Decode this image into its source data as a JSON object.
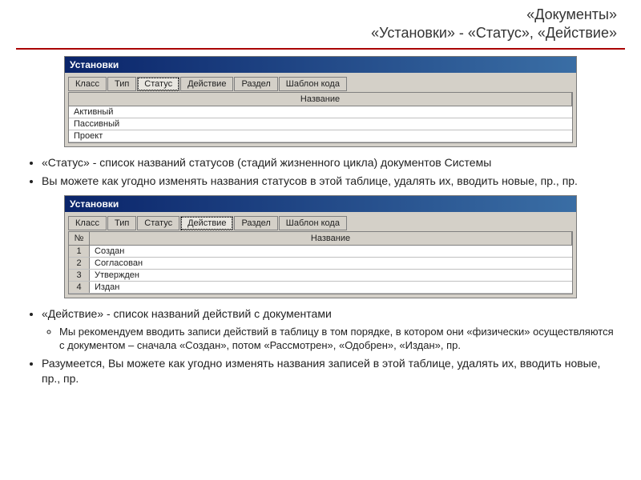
{
  "header": {
    "line1": "«Документы»",
    "line2": "«Установки» - «Статус», «Действие»"
  },
  "win1": {
    "title": "Установки",
    "tabs": [
      "Класс",
      "Тип",
      "Статус",
      "Действие",
      "Раздел",
      "Шаблон кода"
    ],
    "active_tab_index": 2,
    "column_header": "Название",
    "rows": [
      "Активный",
      "Пассивный",
      "Проект"
    ]
  },
  "text1": {
    "b1": "«Статус» - список названий статусов (стадий жизненного цикла) документов Системы",
    "b2": "Вы можете как угодно изменять названия статусов в этой таблице, удалять их, вводить новые, пр., пр."
  },
  "win2": {
    "title": "Установки",
    "tabs": [
      "Класс",
      "Тип",
      "Статус",
      "Действие",
      "Раздел",
      "Шаблон кода"
    ],
    "active_tab_index": 3,
    "idx_header": "№",
    "column_header": "Название",
    "rows": [
      {
        "n": "1",
        "v": "Создан"
      },
      {
        "n": "2",
        "v": "Согласован"
      },
      {
        "n": "3",
        "v": "Утвержден"
      },
      {
        "n": "4",
        "v": "Издан"
      }
    ]
  },
  "text2": {
    "b1": "«Действие» - список названий действий с документами",
    "b1s1": "Мы рекомендуем вводить записи действий в таблицу в том порядке, в котором они «физически» осуществляются с документом – сначала «Создан», потом «Рассмотрен», «Одобрен», «Издан», пр.",
    "b2": "Разумеется, Вы можете как угодно изменять названия записей в этой таблице, удалять их, вводить новые, пр., пр."
  }
}
